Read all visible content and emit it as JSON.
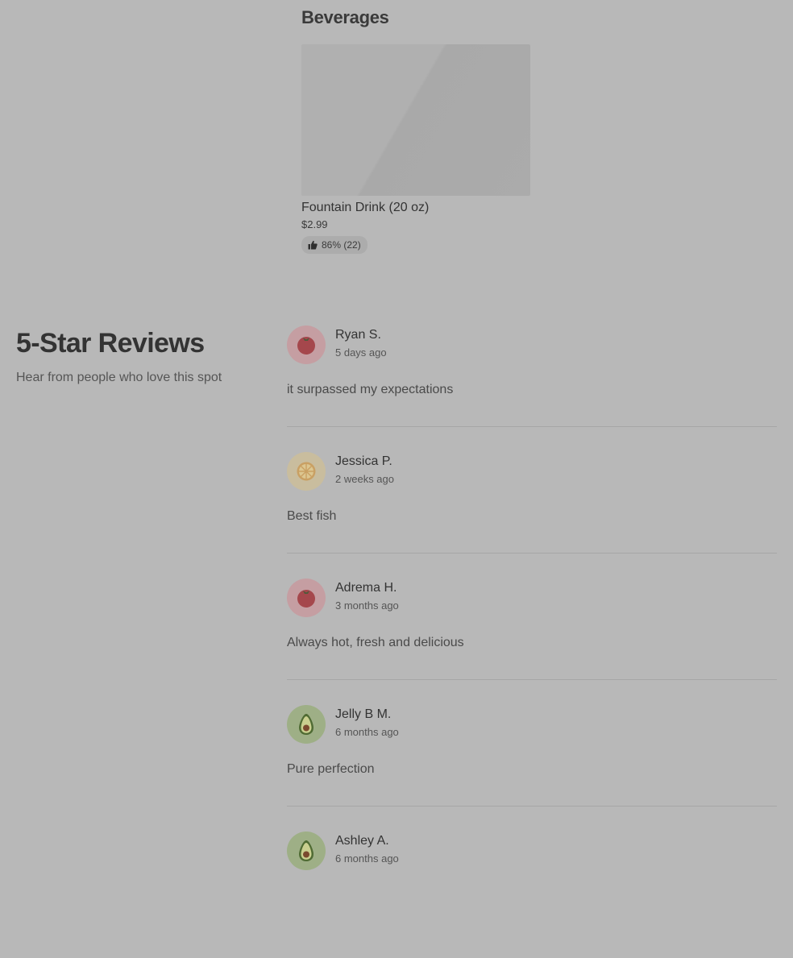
{
  "beverages": {
    "heading": "Beverages",
    "items": [
      {
        "name": "Fountain Drink (20 oz)",
        "price": "$2.99",
        "rating": "86% (22)"
      }
    ]
  },
  "reviews": {
    "title": "5-Star Reviews",
    "subtitle": "Hear from people who love this spot",
    "items": [
      {
        "name": "Ryan S.",
        "date": "5 days ago",
        "text": "it surpassed my expectations",
        "avatar": "tomato-icon"
      },
      {
        "name": "Jessica P.",
        "date": "2 weeks ago",
        "text": "Best fish",
        "avatar": "lemon-icon"
      },
      {
        "name": "Adrema H.",
        "date": "3 months ago",
        "text": "Always hot, fresh and delicious",
        "avatar": "tomato-icon"
      },
      {
        "name": "Jelly B M.",
        "date": "6 months ago",
        "text": "Pure perfection",
        "avatar": "avocado-icon"
      },
      {
        "name": "Ashley A.",
        "date": "6 months ago",
        "text": "",
        "avatar": "avocado-icon"
      }
    ]
  },
  "colors": {
    "page_background": "#b8b8b8",
    "divider": "#a6a6a6"
  }
}
